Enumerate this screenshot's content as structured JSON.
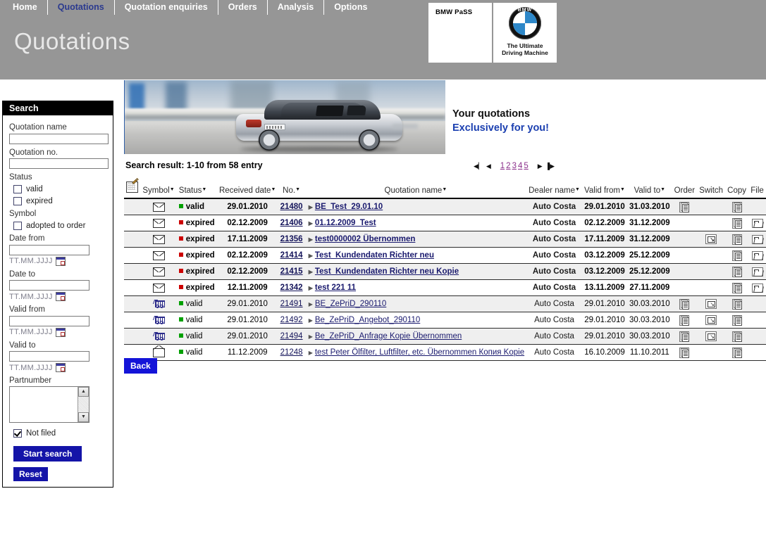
{
  "nav": {
    "items": [
      {
        "label": "Home",
        "active": false
      },
      {
        "label": "Quotations",
        "active": true
      },
      {
        "label": "Quotation enquiries",
        "active": false
      },
      {
        "label": "Orders",
        "active": false
      },
      {
        "label": "Analysis",
        "active": false
      },
      {
        "label": "Options",
        "active": false
      }
    ]
  },
  "header": {
    "page_title": "Quotations",
    "brand_pass": "BMW PaSS",
    "bmw_letters": "BMW",
    "tagline_line1": "The Ultimate",
    "tagline_line2": "Driving Machine"
  },
  "sidebar": {
    "title": "Search",
    "quotation_name_label": "Quotation name",
    "quotation_name_value": "",
    "quotation_no_label": "Quotation no.",
    "quotation_no_value": "",
    "status_label": "Status",
    "status_valid_label": "valid",
    "status_valid_checked": false,
    "status_expired_label": "expired",
    "status_expired_checked": false,
    "symbol_label": "Symbol",
    "symbol_adopted_label": "adopted to order",
    "symbol_adopted_checked": false,
    "date_from_label": "Date from",
    "date_from_value": "",
    "date_to_label": "Date to",
    "date_to_value": "",
    "valid_from_label": "Valid from",
    "valid_from_value": "",
    "valid_to_label": "Valid to",
    "valid_to_value": "",
    "date_format_hint": "TT.MM.JJJJ",
    "partnumber_label": "Partnumber",
    "partnumber_value": "",
    "not_filed_label": "Not filed",
    "not_filed_checked": true,
    "start_search_label": "Start search",
    "reset_label": "Reset"
  },
  "hero": {
    "headline_1": "Your quotations",
    "headline_2": "Exclusively for you!"
  },
  "results": {
    "summary": "Search result: 1-10 from 58 entry",
    "pager": {
      "first": "◀▏",
      "prev": "◀",
      "pages": [
        "1",
        "2",
        "3",
        "4",
        "5"
      ],
      "current_page": "1",
      "next": "▶",
      "last": "▐▶"
    },
    "back_label": "Back"
  },
  "table": {
    "columns": [
      {
        "key": "edit",
        "label": "",
        "sortable": false
      },
      {
        "key": "symbol",
        "label": "Symbol",
        "sortable": true
      },
      {
        "key": "status",
        "label": "Status",
        "sortable": true
      },
      {
        "key": "received",
        "label": "Received date",
        "sortable": true
      },
      {
        "key": "no",
        "label": "No.",
        "sortable": true
      },
      {
        "key": "name",
        "label": "Quotation name",
        "sortable": true
      },
      {
        "key": "dealer",
        "label": "Dealer name",
        "sortable": true
      },
      {
        "key": "valid_from",
        "label": "Valid from",
        "sortable": true
      },
      {
        "key": "valid_to",
        "label": "Valid to",
        "sortable": true
      },
      {
        "key": "order",
        "label": "Order",
        "sortable": false
      },
      {
        "key": "switch",
        "label": "Switch",
        "sortable": false
      },
      {
        "key": "copy",
        "label": "Copy",
        "sortable": false
      },
      {
        "key": "file",
        "label": "File",
        "sortable": false
      }
    ],
    "rows": [
      {
        "symbol_icon": "envelope-closed-icon",
        "status": "valid",
        "status_color": "#00a000",
        "received": "29.01.2010",
        "no": "21480",
        "name": "BE_Test_29.01.10",
        "dealer": "Auto Costa",
        "valid_from": "29.01.2010",
        "valid_to": "31.03.2010",
        "order": true,
        "switch": false,
        "copy": true,
        "file": false,
        "bold": true
      },
      {
        "symbol_icon": "envelope-closed-icon",
        "status": "expired",
        "status_color": "#cc0000",
        "received": "02.12.2009",
        "no": "21406",
        "name": "01.12.2009_Test",
        "dealer": "Auto Costa",
        "valid_from": "02.12.2009",
        "valid_to": "31.12.2009",
        "order": false,
        "switch": false,
        "copy": true,
        "file": true,
        "bold": true
      },
      {
        "symbol_icon": "envelope-closed-icon",
        "status": "expired",
        "status_color": "#cc0000",
        "received": "17.11.2009",
        "no": "21356",
        "name": "test0000002 Übernommen",
        "dealer": "Auto Costa",
        "valid_from": "17.11.2009",
        "valid_to": "31.12.2009",
        "order": false,
        "switch": true,
        "copy": true,
        "file": true,
        "bold": true
      },
      {
        "symbol_icon": "envelope-closed-icon",
        "status": "expired",
        "status_color": "#cc0000",
        "received": "02.12.2009",
        "no": "21414",
        "name": "Test_Kundendaten Richter neu",
        "dealer": "Auto Costa",
        "valid_from": "03.12.2009",
        "valid_to": "25.12.2009",
        "order": false,
        "switch": false,
        "copy": true,
        "file": true,
        "bold": true
      },
      {
        "symbol_icon": "envelope-closed-icon",
        "status": "expired",
        "status_color": "#cc0000",
        "received": "02.12.2009",
        "no": "21415",
        "name": "Test_Kundendaten Richter neu Kopie",
        "dealer": "Auto Costa",
        "valid_from": "03.12.2009",
        "valid_to": "25.12.2009",
        "order": false,
        "switch": false,
        "copy": true,
        "file": true,
        "bold": true
      },
      {
        "symbol_icon": "envelope-closed-icon",
        "status": "expired",
        "status_color": "#cc0000",
        "received": "12.11.2009",
        "no": "21342",
        "name": "test 221 11",
        "dealer": "Auto Costa",
        "valid_from": "13.11.2009",
        "valid_to": "27.11.2009",
        "order": false,
        "switch": false,
        "copy": true,
        "file": true,
        "bold": true
      },
      {
        "symbol_icon": "shopping-cart-icon",
        "status": "valid",
        "status_color": "#00a000",
        "received": "29.01.2010",
        "no": "21491",
        "name": "BE_ZePriD_290110",
        "dealer": "Auto Costa",
        "valid_from": "29.01.2010",
        "valid_to": "30.03.2010",
        "order": true,
        "switch": true,
        "copy": true,
        "file": false,
        "bold": false
      },
      {
        "symbol_icon": "shopping-cart-icon",
        "status": "valid",
        "status_color": "#00a000",
        "received": "29.01.2010",
        "no": "21492",
        "name": "Be_ZePriD_Angebot_290110",
        "dealer": "Auto Costa",
        "valid_from": "29.01.2010",
        "valid_to": "30.03.2010",
        "order": true,
        "switch": true,
        "copy": true,
        "file": false,
        "bold": false
      },
      {
        "symbol_icon": "shopping-cart-icon",
        "status": "valid",
        "status_color": "#00a000",
        "received": "29.01.2010",
        "no": "21494",
        "name": "Be_ZePriD_Anfrage Kopie Übernommen",
        "dealer": "Auto Costa",
        "valid_from": "29.01.2010",
        "valid_to": "30.03.2010",
        "order": true,
        "switch": true,
        "copy": true,
        "file": false,
        "bold": false
      },
      {
        "symbol_icon": "envelope-open-icon",
        "status": "valid",
        "status_color": "#00a000",
        "received": "11.12.2009",
        "no": "21248",
        "name": "test Peter Ölfilter, Luftfilter, etc. Übernommen Копия Kopie",
        "dealer": "Auto Costa",
        "valid_from": "16.10.2009",
        "valid_to": "11.10.2011",
        "order": true,
        "switch": false,
        "copy": true,
        "file": false,
        "bold": false
      }
    ]
  },
  "colors": {
    "banner_gray": "#969696",
    "nav_active": "#2b3a8f",
    "link_blue": "#1a1a6e",
    "button_blue": "#1414a8",
    "status_valid": "#00a000",
    "status_expired": "#cc0000",
    "row_alt": "#efefef"
  }
}
